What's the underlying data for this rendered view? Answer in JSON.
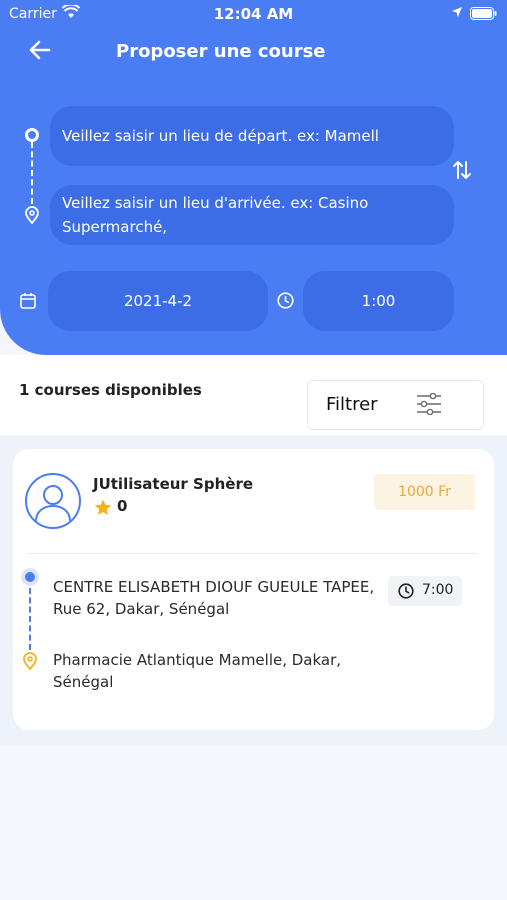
{
  "status_bar": {
    "carrier": "Carrier",
    "time": "12:04 AM"
  },
  "header": {
    "title": "Proposer une course"
  },
  "form": {
    "departure_placeholder": "Veillez saisir un lieu de départ. ex: Mamell",
    "arrival_placeholder": " Veillez saisir un lieu d'arrivée. ex: Casino Supermarché,",
    "date": "2021-4-2",
    "time": "1:00"
  },
  "results": {
    "count_label": "1 courses disponibles",
    "filter_label": "Filtrer"
  },
  "rides": [
    {
      "user_name": "JUtilisateur Sphère",
      "rating": "0",
      "price": "1000 Fr",
      "departure": "CENTRE ELISABETH DIOUF GUEULE TAPEE, Rue 62, Dakar, Sénégal",
      "arrival": "Pharmacie Atlantique Mamelle, Dakar, Sénégal",
      "time": "7:00"
    }
  ],
  "colors": {
    "primary": "#4a7cf4",
    "field": "#3c6de6",
    "accent": "#e8a93a",
    "star": "#f5b21c"
  },
  "icons": [
    "wifi-icon",
    "location-arrow-icon",
    "battery-icon",
    "back-arrow-icon",
    "departure-dot-icon",
    "arrival-pin-icon",
    "swap-icon",
    "calendar-icon",
    "clock-icon",
    "filter-sliders-icon",
    "user-avatar-icon",
    "star-icon"
  ]
}
